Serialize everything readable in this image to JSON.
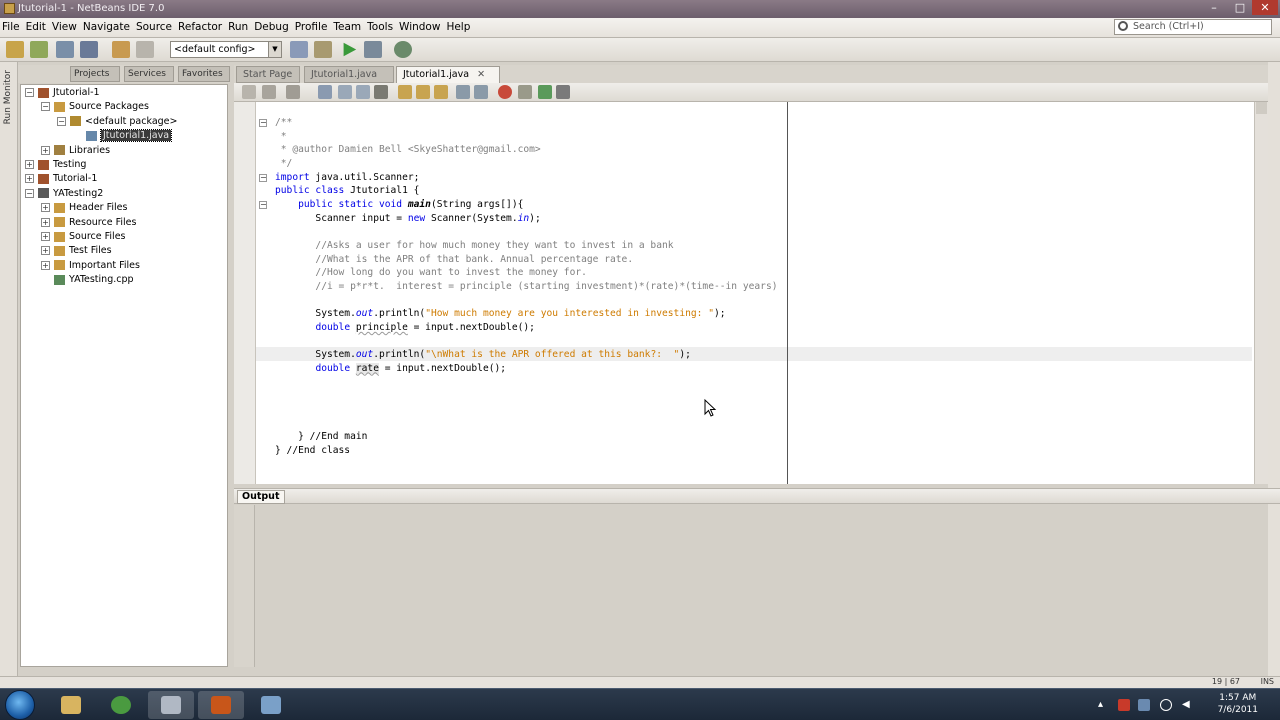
{
  "window": {
    "title": "Jtutorial-1 - NetBeans IDE 7.0",
    "controls": {
      "minimize": "–",
      "maximize": "□",
      "close": "✕"
    }
  },
  "menubar": {
    "items": [
      "File",
      "Edit",
      "View",
      "Navigate",
      "Source",
      "Refactor",
      "Run",
      "Debug",
      "Profile",
      "Team",
      "Tools",
      "Window",
      "Help"
    ],
    "search_placeholder": "Search (Ctrl+I)"
  },
  "toolbar": {
    "config": "<default config>"
  },
  "left_strip": {
    "label": "Run Monitor"
  },
  "project_tabs": [
    "Projects",
    "Services",
    "Favorites"
  ],
  "project_tree": [
    {
      "label": "Jtutorial-1",
      "indent": 0,
      "expander": "−",
      "icon": "project-icon",
      "color": "#a0522d"
    },
    {
      "label": "Source Packages",
      "indent": 1,
      "expander": "−",
      "icon": "package-folder-icon",
      "color": "#c89a40"
    },
    {
      "label": "<default package>",
      "indent": 2,
      "expander": "−",
      "icon": "package-icon",
      "color": "#b08a30"
    },
    {
      "label": "Jtutorial1.java",
      "indent": 3,
      "expander": "",
      "icon": "java-file-icon",
      "color": "#6688aa",
      "selected": true
    },
    {
      "label": "Libraries",
      "indent": 1,
      "expander": "+",
      "icon": "libraries-icon",
      "color": "#a08040"
    },
    {
      "label": "Testing",
      "indent": 0,
      "expander": "+",
      "icon": "project-icon",
      "color": "#a0522d"
    },
    {
      "label": "Tutorial-1",
      "indent": 0,
      "expander": "+",
      "icon": "project-icon",
      "color": "#a0522d"
    },
    {
      "label": "YATesting2",
      "indent": 0,
      "expander": "−",
      "icon": "project-icon",
      "color": "#5a5a5a"
    },
    {
      "label": "Header Files",
      "indent": 1,
      "expander": "+",
      "icon": "folder-icon",
      "color": "#c89a40"
    },
    {
      "label": "Resource Files",
      "indent": 1,
      "expander": "+",
      "icon": "folder-icon",
      "color": "#c89a40"
    },
    {
      "label": "Source Files",
      "indent": 1,
      "expander": "+",
      "icon": "folder-icon",
      "color": "#c89a40"
    },
    {
      "label": "Test Files",
      "indent": 1,
      "expander": "+",
      "icon": "folder-icon",
      "color": "#c89a40"
    },
    {
      "label": "Important Files",
      "indent": 1,
      "expander": "+",
      "icon": "folder-icon",
      "color": "#c89a40"
    },
    {
      "label": "YATesting.cpp",
      "indent": 1,
      "expander": "",
      "icon": "cpp-file-icon",
      "color": "#5a8a5a"
    }
  ],
  "editor_tabs": [
    {
      "label": "Start Page",
      "active": false
    },
    {
      "label": "Jtutorial1.java",
      "active": false
    },
    {
      "label": "Jtutorial1.java",
      "active": true
    }
  ],
  "code_lines": [
    [
      {
        "t": "/**",
        "c": "cm"
      }
    ],
    [
      {
        "t": " *",
        "c": "cm"
      }
    ],
    [
      {
        "t": " * @author Damien Bell <SkyeShatter@gmail.com>",
        "c": "cm"
      }
    ],
    [
      {
        "t": " */",
        "c": "cm"
      }
    ],
    [
      {
        "t": "import",
        "c": "kw"
      },
      {
        "t": " java.util.Scanner;",
        "c": ""
      }
    ],
    [
      {
        "t": "public class",
        "c": "kw"
      },
      {
        "t": " Jtutorial1 {",
        "c": ""
      }
    ],
    [
      {
        "t": "    public static void ",
        "c": "kw"
      },
      {
        "t": "main",
        "c": "it fn"
      },
      {
        "t": "(String args[]){",
        "c": ""
      }
    ],
    [
      {
        "t": "       Scanner input = ",
        "c": ""
      },
      {
        "t": "new",
        "c": "kw"
      },
      {
        "t": " Scanner(System.",
        "c": ""
      },
      {
        "t": "in",
        "c": "it kw"
      },
      {
        "t": ");",
        "c": ""
      }
    ],
    [
      {
        "t": "",
        "c": ""
      }
    ],
    [
      {
        "t": "       //Asks a user for how much money they want to invest in a bank",
        "c": "cm"
      }
    ],
    [
      {
        "t": "       //What is the APR of that bank. Annual percentage rate.",
        "c": "cm"
      }
    ],
    [
      {
        "t": "       //How long do you want to invest the money for.",
        "c": "cm"
      }
    ],
    [
      {
        "t": "       //i = p*r*t.  interest = principle (starting investment)*(rate)*(time--in years)",
        "c": "cm"
      }
    ],
    [
      {
        "t": "",
        "c": ""
      }
    ],
    [
      {
        "t": "       System.",
        "c": ""
      },
      {
        "t": "out",
        "c": "it kw"
      },
      {
        "t": ".println(",
        "c": ""
      },
      {
        "t": "\"How much money are you interested in investing: \"",
        "c": "st"
      },
      {
        "t": ");",
        "c": ""
      }
    ],
    [
      {
        "t": "       ",
        "c": ""
      },
      {
        "t": "double",
        "c": "kw"
      },
      {
        "t": " ",
        "c": ""
      },
      {
        "t": "principle",
        "c": "ul"
      },
      {
        "t": " = input.nextDouble();",
        "c": ""
      }
    ],
    [
      {
        "t": "",
        "c": ""
      }
    ],
    [
      {
        "t": "       System.",
        "c": ""
      },
      {
        "t": "out",
        "c": "it kw"
      },
      {
        "t": ".println(",
        "c": ""
      },
      {
        "t": "\"\\nWhat is the APR offered at this bank?:  \"",
        "c": "st"
      },
      {
        "t": ");",
        "c": ""
      }
    ],
    [
      {
        "t": "       ",
        "c": ""
      },
      {
        "t": "double",
        "c": "kw"
      },
      {
        "t": " ",
        "c": ""
      },
      {
        "t": "rate",
        "c": "ul hl"
      },
      {
        "t": " = input.nextDouble();",
        "c": ""
      }
    ],
    [
      {
        "t": "",
        "c": ""
      }
    ],
    [
      {
        "t": "",
        "c": ""
      }
    ],
    [
      {
        "t": "",
        "c": ""
      }
    ],
    [
      {
        "t": "",
        "c": ""
      }
    ],
    [
      {
        "t": "    } //End main",
        "c": ""
      }
    ],
    [
      {
        "t": "} //End class",
        "c": ""
      }
    ]
  ],
  "output": {
    "tab_label": "Output"
  },
  "status": {
    "position": "19 | 67",
    "mode": "INS"
  },
  "taskbar": {
    "apps": [
      {
        "name": "explorer",
        "color": "#d8b460"
      },
      {
        "name": "chrome",
        "color": "#4a9a40"
      },
      {
        "name": "window",
        "color": "#b0b8c4"
      },
      {
        "name": "media",
        "color": "#c8561a"
      },
      {
        "name": "netbeans",
        "color": "#7aa0c8"
      }
    ],
    "clock_time": "1:57 AM",
    "clock_date": "7/6/2011"
  }
}
